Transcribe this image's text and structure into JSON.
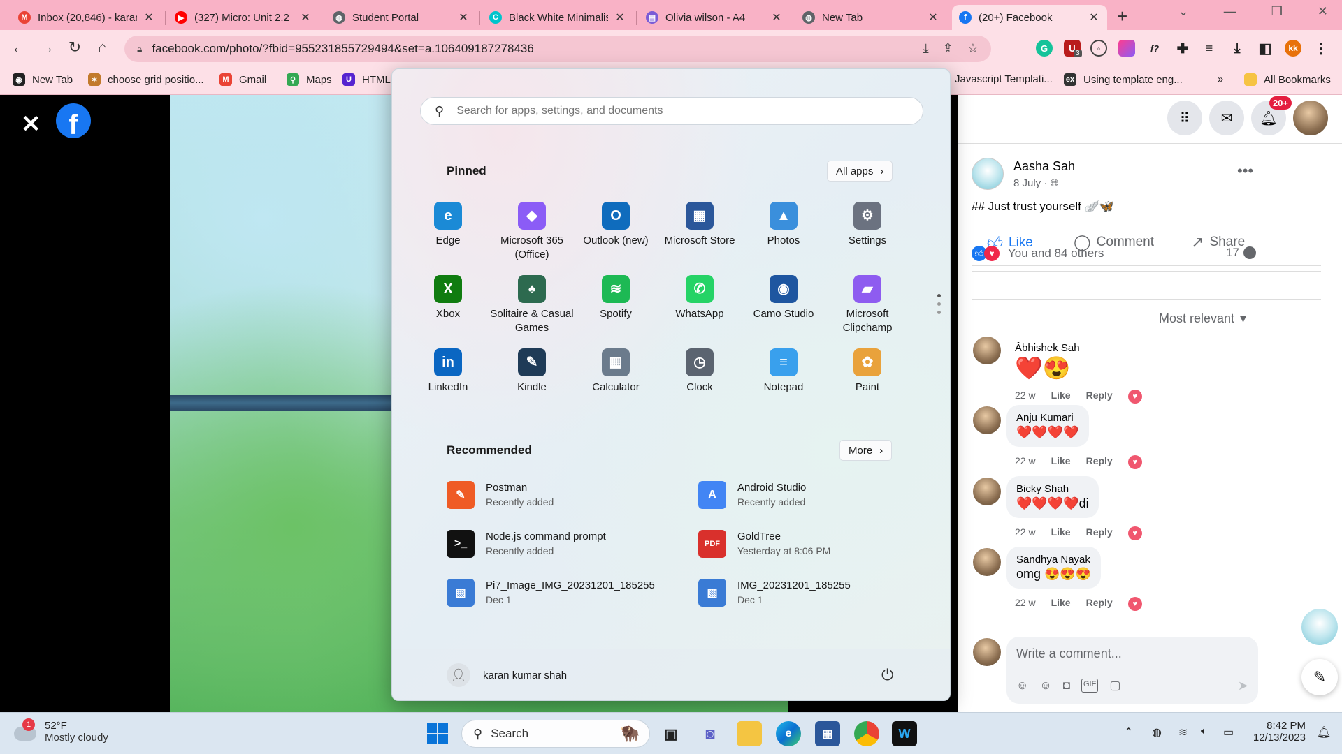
{
  "browser": {
    "tabs": [
      {
        "title": "Inbox (20,846) - karan",
        "icon": "gmail-icon",
        "color": "#ea4335",
        "glyph": "M"
      },
      {
        "title": "(327) Micro: Unit 2.2",
        "icon": "youtube-icon",
        "color": "#ff0000",
        "glyph": "▶"
      },
      {
        "title": "Student Portal",
        "icon": "globe-icon",
        "color": "#5f6368",
        "glyph": "◍"
      },
      {
        "title": "Black White Minimalis",
        "icon": "canva-icon",
        "color": "#00c4cc",
        "glyph": "C"
      },
      {
        "title": "Olivia wilson - A4",
        "icon": "print-icon",
        "color": "#7b5cd6",
        "glyph": "▤"
      },
      {
        "title": "New Tab",
        "icon": "chrome-icon",
        "color": "#5f6368",
        "glyph": "◍"
      },
      {
        "title": "(20+) Facebook",
        "icon": "facebook-icon",
        "color": "#1877f2",
        "glyph": "f"
      }
    ],
    "url": "facebook.com/photo/?fbid=955231855729494&set=a.106409187278436",
    "profile_initials": "kk",
    "ext_badge": "3",
    "bookmarks": [
      {
        "label": "New Tab",
        "icon": "github-icon",
        "color": "#222",
        "glyph": "◉"
      },
      {
        "label": "choose grid positio...",
        "icon": "grid-icon",
        "color": "#c27a2c",
        "glyph": "✶"
      },
      {
        "label": "Gmail",
        "icon": "gmail-icon",
        "color": "#ea4335",
        "glyph": "M"
      },
      {
        "label": "Maps",
        "icon": "maps-icon",
        "color": "#34a853",
        "glyph": "⚲"
      },
      {
        "label": "HTML",
        "icon": "udemy-icon",
        "color": "#5624d0",
        "glyph": "U"
      },
      {
        "label": "Javascript Templati...",
        "icon": "",
        "color": "",
        "glyph": ""
      },
      {
        "label": "Using template eng...",
        "icon": "expert-icon",
        "color": "#333",
        "glyph": "ex"
      },
      {
        "label": "All Bookmarks",
        "icon": "folder-icon",
        "color": "#f6c343",
        "glyph": ""
      }
    ]
  },
  "start_menu": {
    "search_placeholder": "Search for apps, settings, and documents",
    "pinned_heading": "Pinned",
    "all_apps_label": "All apps",
    "pinned": [
      {
        "label": "Edge",
        "icon": "edge-icon",
        "color": "#1b8ad6",
        "glyph": "e"
      },
      {
        "label": "Microsoft 365 (Office)",
        "icon": "office-icon",
        "color": "#8b5cf6",
        "glyph": "◆"
      },
      {
        "label": "Outlook (new)",
        "icon": "outlook-icon",
        "color": "#0f6cbd",
        "glyph": "O"
      },
      {
        "label": "Microsoft Store",
        "icon": "store-icon",
        "color": "#2b579a",
        "glyph": "▦"
      },
      {
        "label": "Photos",
        "icon": "photos-icon",
        "color": "#3a8fdc",
        "glyph": "▲"
      },
      {
        "label": "Settings",
        "icon": "settings-icon",
        "color": "#6b7280",
        "glyph": "⚙"
      },
      {
        "label": "Xbox",
        "icon": "xbox-icon",
        "color": "#107c10",
        "glyph": "X"
      },
      {
        "label": "Solitaire & Casual Games",
        "icon": "solitaire-icon",
        "color": "#2d6a4f",
        "glyph": "♠"
      },
      {
        "label": "Spotify",
        "icon": "spotify-icon",
        "color": "#1db954",
        "glyph": "≋"
      },
      {
        "label": "WhatsApp",
        "icon": "whatsapp-icon",
        "color": "#25d366",
        "glyph": "✆"
      },
      {
        "label": "Camo Studio",
        "icon": "camo-icon",
        "color": "#1e56a0",
        "glyph": "◉"
      },
      {
        "label": "Microsoft Clipchamp",
        "icon": "clipchamp-icon",
        "color": "#8e5cf0",
        "glyph": "▰"
      },
      {
        "label": "LinkedIn",
        "icon": "linkedin-icon",
        "color": "#0a66c2",
        "glyph": "in"
      },
      {
        "label": "Kindle",
        "icon": "kindle-icon",
        "color": "#1f3b57",
        "glyph": "✎"
      },
      {
        "label": "Calculator",
        "icon": "calculator-icon",
        "color": "#6b7b8c",
        "glyph": "▦"
      },
      {
        "label": "Clock",
        "icon": "clock-icon",
        "color": "#5b6470",
        "glyph": "◷"
      },
      {
        "label": "Notepad",
        "icon": "notepad-icon",
        "color": "#39a0ed",
        "glyph": "≡"
      },
      {
        "label": "Paint",
        "icon": "paint-icon",
        "color": "#e9a23b",
        "glyph": "✿"
      }
    ],
    "recommended_heading": "Recommended",
    "more_label": "More",
    "recommended": [
      {
        "name": "Postman",
        "sub": "Recently added",
        "icon": "postman-icon",
        "color": "#ef5b25",
        "glyph": "✎"
      },
      {
        "name": "Android Studio",
        "sub": "Recently added",
        "icon": "android-studio-icon",
        "color": "#4285f4",
        "glyph": "A"
      },
      {
        "name": "Node.js command prompt",
        "sub": "Recently added",
        "icon": "terminal-icon",
        "color": "#111",
        "glyph": ">_"
      },
      {
        "name": "GoldTree",
        "sub": "Yesterday at 8:06 PM",
        "icon": "pdf-icon",
        "color": "#d9302c",
        "glyph": "PDF"
      },
      {
        "name": "Pi7_Image_IMG_20231201_185255",
        "sub": "Dec 1",
        "icon": "image-file-icon",
        "color": "#3a7bd5",
        "glyph": "▧"
      },
      {
        "name": "IMG_20231201_185255",
        "sub": "Dec 1",
        "icon": "image-file-icon",
        "color": "#3a7bd5",
        "glyph": "▧"
      }
    ],
    "user_name": "karan kumar shah"
  },
  "facebook": {
    "notification_badge": "20+",
    "post": {
      "author": "Aasha Sah",
      "date": "8 July ·",
      "text": "## Just trust yourself 🪽🦋",
      "reactions_text": "You and 84 others",
      "comment_count": "17",
      "like_label": "Like",
      "comment_label": "Comment",
      "share_label": "Share",
      "sort_label": "Most relevant"
    },
    "comments": [
      {
        "author": "Âbhishek Sah",
        "text": "❤️😍",
        "time": "22 w"
      },
      {
        "author": "Anju Kumari",
        "text": "❤️❤️❤️❤️",
        "time": "22 w"
      },
      {
        "author": "Bicky Shah",
        "text": "❤️❤️❤️❤️di",
        "time": "22 w"
      },
      {
        "author": "Sandhya Nayak",
        "text": "omg 😍😍😍",
        "time": "22 w"
      }
    ],
    "comment_like": "Like",
    "comment_reply": "Reply",
    "write_placeholder": "Write a comment..."
  },
  "taskbar": {
    "weather_temp": "52°F",
    "weather_desc": "Mostly cloudy",
    "weather_badge": "1",
    "search_label": "Search",
    "time": "8:42 PM",
    "date": "12/13/2023"
  }
}
